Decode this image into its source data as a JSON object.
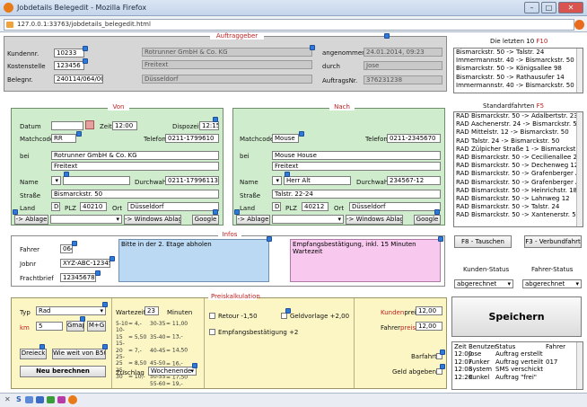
{
  "window": {
    "title": "Jobdetails Belegedit - Mozilla Firefox",
    "url": "127.0.0.1:33763/jobdetails_belegedit.html"
  },
  "auftraggeber": {
    "title": "Auftraggeber",
    "kundennr_label": "Kundennr.",
    "kundennr": "10233",
    "kostenstelle_label": "Kostenstelle",
    "kostenstelle": "123456",
    "belegnr_label": "Belegnr.",
    "belegnr": "240114/064/004",
    "firma": "Rotrunner GmbH & Co. KG",
    "zeile2": "Freitext",
    "ort": "Düsseldorf",
    "angenommen_label": "angenommen",
    "angenommen": "24.01.2014, 09:23",
    "durch_label": "durch",
    "durch": "Jose",
    "auftragsnr_label": "AuftragsNr.",
    "auftragsnr": "376231238"
  },
  "letzten": {
    "title": "Die letzten 10",
    "key": "F10",
    "items": [
      "Bismarckstr. 50 -> Talstr. 24",
      "Immermannstr. 40 -> Bismarckstr. 50",
      "Bismarckstr. 50 -> Königsallee 98",
      "Bismarckstr. 50 -> Rathausufer 14",
      "Immermannstr. 40 -> Bismarckstr. 50"
    ]
  },
  "standard": {
    "title": "Standardfahrten",
    "key": "F5",
    "items": [
      "RAD Bismarckstr. 50 -> Adalbertstr. 23",
      "RAD Aachenerstr. 24 -> Bismarckstr. 50",
      "RAD Mittelstr. 12 -> Bismarckstr. 50",
      "RAD Talstr. 24 -> Bismarckstr. 50",
      "RAD Zülpicher Straße 1 -> Bismarckstr. 50",
      "RAD Bismarckstr. 50 -> Cecilienallee 23",
      "RAD Bismarckstr. 50 -> Dechenweg 12",
      "RAD Bismarckstr. 50 -> Grafenberger Allee 2",
      "RAD Bismarckstr. 50 -> Grafenberger Allee 2",
      "RAD Bismarckstr. 50 -> Heinrichstr. 185",
      "RAD Bismarckstr. 50 -> Lahnweg 12",
      "RAD Bismarckstr. 50 -> Talstr. 24",
      "RAD Bismarckstr. 50 -> Xantenerstr. 5"
    ]
  },
  "von": {
    "title": "Von",
    "datum_label": "Datum",
    "zeit_label": "Zeit",
    "zeit": "12:00",
    "dispozeit_label": "Dispozeit",
    "dispozeit": "12:15",
    "matchcode_label": "Matchcode",
    "matchcode": "RR",
    "telefon_label": "Telefon",
    "telefon": "0211-1799610",
    "bei_label": "bei",
    "bei": "Rotrunner GmbH & Co. KG",
    "zusatz": "Freitext",
    "name_label": "Name",
    "durchwahl_label": "Durchwahl",
    "durchwahl": "0211-17996113",
    "strasse_label": "Straße",
    "strasse": "Bismarckstr. 50",
    "land_label": "Land",
    "land": "D",
    "plz_label": "PLZ",
    "plz": "40210",
    "ort_label": "Ort",
    "ort": "Düsseldorf",
    "ablage": "-> Ablage",
    "windows_ablage": "-> Windows Ablage",
    "google": "Google"
  },
  "nach": {
    "title": "Nach",
    "matchcode_label": "Matchcode",
    "matchcode": "Mouse",
    "telefon_label": "Telefon",
    "telefon": "0211-2345670",
    "bei_label": "bei",
    "bei": "Mouse House",
    "zusatz": "Freitext",
    "name_label": "Name",
    "name": "Herr Alt",
    "durchwahl_label": "Durchwahl",
    "durchwahl": "234567-12",
    "strasse_label": "Straße",
    "strasse": "Talstr. 22-24",
    "land_label": "Land",
    "land": "D",
    "plz_label": "PLZ",
    "plz": "40212",
    "ort_label": "Ort",
    "ort": "Düsseldorf",
    "ablage": "-> Ablage",
    "windows_ablage": "-> Windows Ablage",
    "google": "Google"
  },
  "infos": {
    "title": "Infos",
    "fahrer_label": "Fahrer",
    "fahrer": "064",
    "jobnr_label": "Jobnr",
    "jobnr": "XYZ-ABC-123456",
    "frachtbrief_label": "Frachtbrief",
    "frachtbrief": "123456789",
    "bemerkung": "Bitte in der 2. Etage abholen",
    "empfang": "Empfangsbestätigung, inkl. 15 Minuten Wartezeit"
  },
  "side": {
    "tauschen": "F8 - Tauschen",
    "verbundfahrt": "F3 - Verbundfahrt",
    "kunden_status_label": "Kunden-Status",
    "kunden_status": "abgerechnet",
    "fahrer_status_label": "Fahrer-Status",
    "fahrer_status": "abgerechnet",
    "speichern": "Speichern"
  },
  "preis": {
    "title": "Preiskalkulation",
    "typ_label": "Typ",
    "typ": "Rad",
    "km_label": "km",
    "km": "5",
    "gmap": "Gmap",
    "mg": "M+G",
    "dreieck": "Dreieck",
    "wieweit": "Wie weit von B50",
    "neu": "Neu berechnen",
    "wartezeit_label": "Wartezeit",
    "wartezeit": "23",
    "minuten": "Minuten",
    "tabelle": [
      [
        "5-10",
        "= 4,-",
        "30-35",
        "= 11,00"
      ],
      [
        "10-15",
        "= 5,50",
        "35-40",
        "= 13,-"
      ],
      [
        "15-20",
        "= 7,-",
        "40-45",
        "= 14,50"
      ],
      [
        "25-25",
        "= 8,50",
        "45-50",
        "= 16,-"
      ],
      [
        "25-30",
        "= 10,-",
        "50-55",
        "= 17,50"
      ],
      [
        "",
        "",
        "55-60",
        "= 19,-"
      ]
    ],
    "zuschlag_label": "Zuschlag",
    "zuschlag": "Wochenende",
    "retour": "Retour -1,50",
    "geldvorlage": "Geldvorlage +2,00",
    "empfang": "Empfangsbestätigung +2",
    "kundenpreis_label": "Kundenpreis",
    "kundenpreis": "12,00",
    "fahrerpreis_label": "Fahrerpreis",
    "fahrerpreis": "12,00",
    "barfahrt_label": "Barfahrt",
    "geld_label": "Geld abgeben?"
  },
  "log": {
    "headers": [
      "Zeit",
      "Benutzer",
      "Status",
      "Fahrer"
    ],
    "rows": [
      [
        "12:00",
        "Jose",
        "Auftrag erstellt",
        ""
      ],
      [
        "12:07",
        "Funker",
        "Auftrag verteilt",
        "017"
      ],
      [
        "12:08",
        "System",
        "SMS verschickt",
        ""
      ],
      [
        "12:20",
        "Kunkel",
        "Auftrag \"frei\"",
        ""
      ]
    ]
  },
  "colors": {
    "accent_red": "#c02020",
    "badge_blue": "#2f79d8",
    "green_panel": "#cfeccc",
    "yellow_panel": "#fbf6c4"
  }
}
